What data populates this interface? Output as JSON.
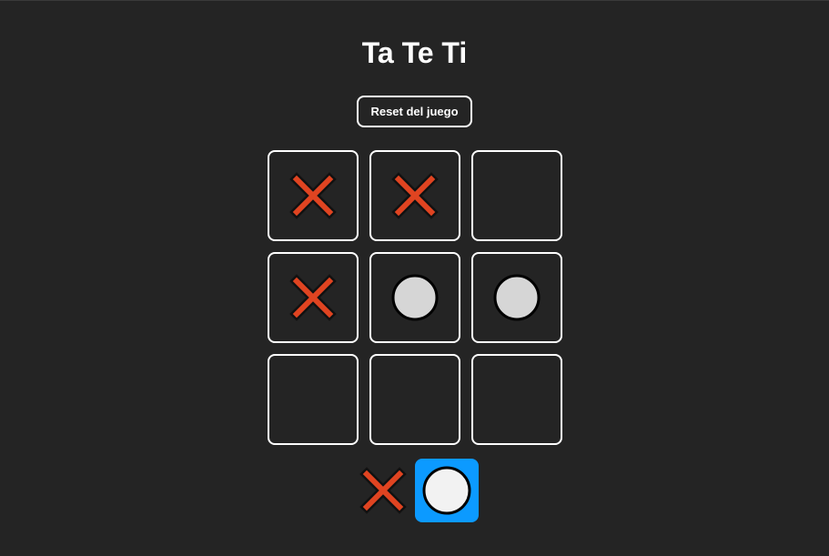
{
  "game": {
    "title": "Ta Te Ti",
    "reset_label": "Reset del juego",
    "board": [
      "x",
      "x",
      "",
      "x",
      "o",
      "o",
      "",
      "",
      ""
    ],
    "current_turn": "o"
  },
  "colors": {
    "background": "#242424",
    "x_fill": "#e04421",
    "o_fill": "#d6d6d6",
    "turn_highlight": "#0c9aff"
  },
  "icons": {
    "x": "x-mark-icon",
    "o": "o-mark-icon"
  }
}
